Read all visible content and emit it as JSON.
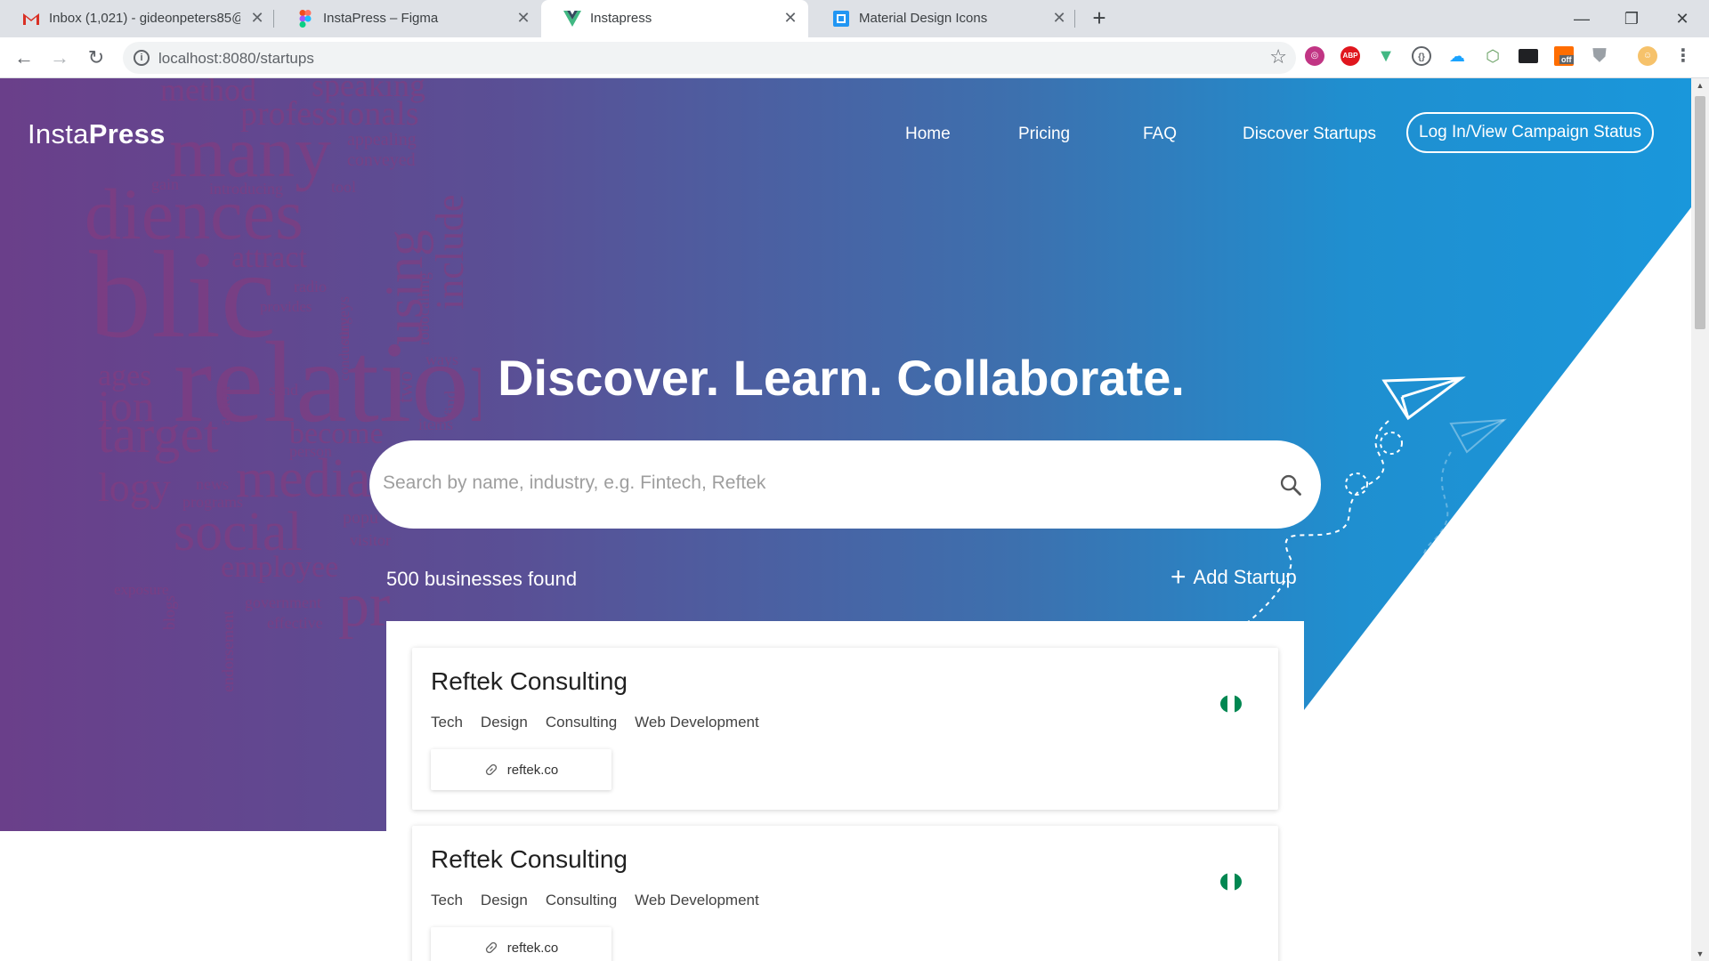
{
  "browser": {
    "tabs": [
      {
        "title": "Inbox (1,021) - gideonpeters85@",
        "icon": "gmail-icon"
      },
      {
        "title": "InstaPress – Figma",
        "icon": "figma-icon"
      },
      {
        "title": "Instapress",
        "icon": "vue-icon"
      },
      {
        "title": "Material Design Icons",
        "icon": "mdi-icon"
      }
    ],
    "url": "localhost:8080/startups",
    "extensions": [
      "instagram-icon",
      "adblock-icon",
      "vue-devtools-icon",
      "braces-icon",
      "cloud-icon",
      "nodejs-icon",
      "terminal-icon",
      "off-badge-icon",
      "shield-icon",
      "avatar"
    ],
    "extension_badge": "off"
  },
  "brand": {
    "logo_light": "Insta",
    "logo_bold": "Press"
  },
  "nav": {
    "home": "Home",
    "pricing": "Pricing",
    "faq": "FAQ",
    "discover": "Discover Startups",
    "login": "Log In/View Campaign Status"
  },
  "hero": {
    "headline": "Discover. Learn. Collaborate."
  },
  "search": {
    "placeholder": "Search by name, industry, e.g. Fintech, Reftek",
    "value": ""
  },
  "results": {
    "count_text": "500 businesses found",
    "add_label": "Add Startup"
  },
  "wordcloud": [
    "speaking",
    "method",
    "professionals",
    "many",
    "appealing",
    "conveyed",
    "diences",
    "tool",
    "include",
    "using",
    "attract",
    "radio",
    "provides",
    "robocalling",
    "surveys",
    "blic",
    "relations",
    "send",
    "two",
    "target",
    "become",
    "items",
    "person",
    "media",
    "news",
    "programs",
    "social",
    "popu",
    "visitor",
    "employee",
    "pr",
    "government",
    "effective",
    "endorsement",
    "exposure",
    "blogs",
    "action",
    "conducting",
    "ways",
    "find",
    "gain",
    "introducing",
    "logy",
    "ages",
    "ion"
  ],
  "startups": [
    {
      "name": "Reftek Consulting",
      "tags": [
        "Tech",
        "Design",
        "Consulting",
        "Web Development"
      ],
      "website": "reftek.co",
      "flag": "nigeria-flag-icon"
    },
    {
      "name": "Reftek Consulting",
      "tags": [
        "Tech",
        "Design",
        "Consulting",
        "Web Development"
      ],
      "website": "reftek.co",
      "flag": "nigeria-flag-icon"
    }
  ],
  "colors": {
    "hero_left": "#6a3f8a",
    "hero_right": "#1a97db",
    "flag_green": "#008751"
  }
}
